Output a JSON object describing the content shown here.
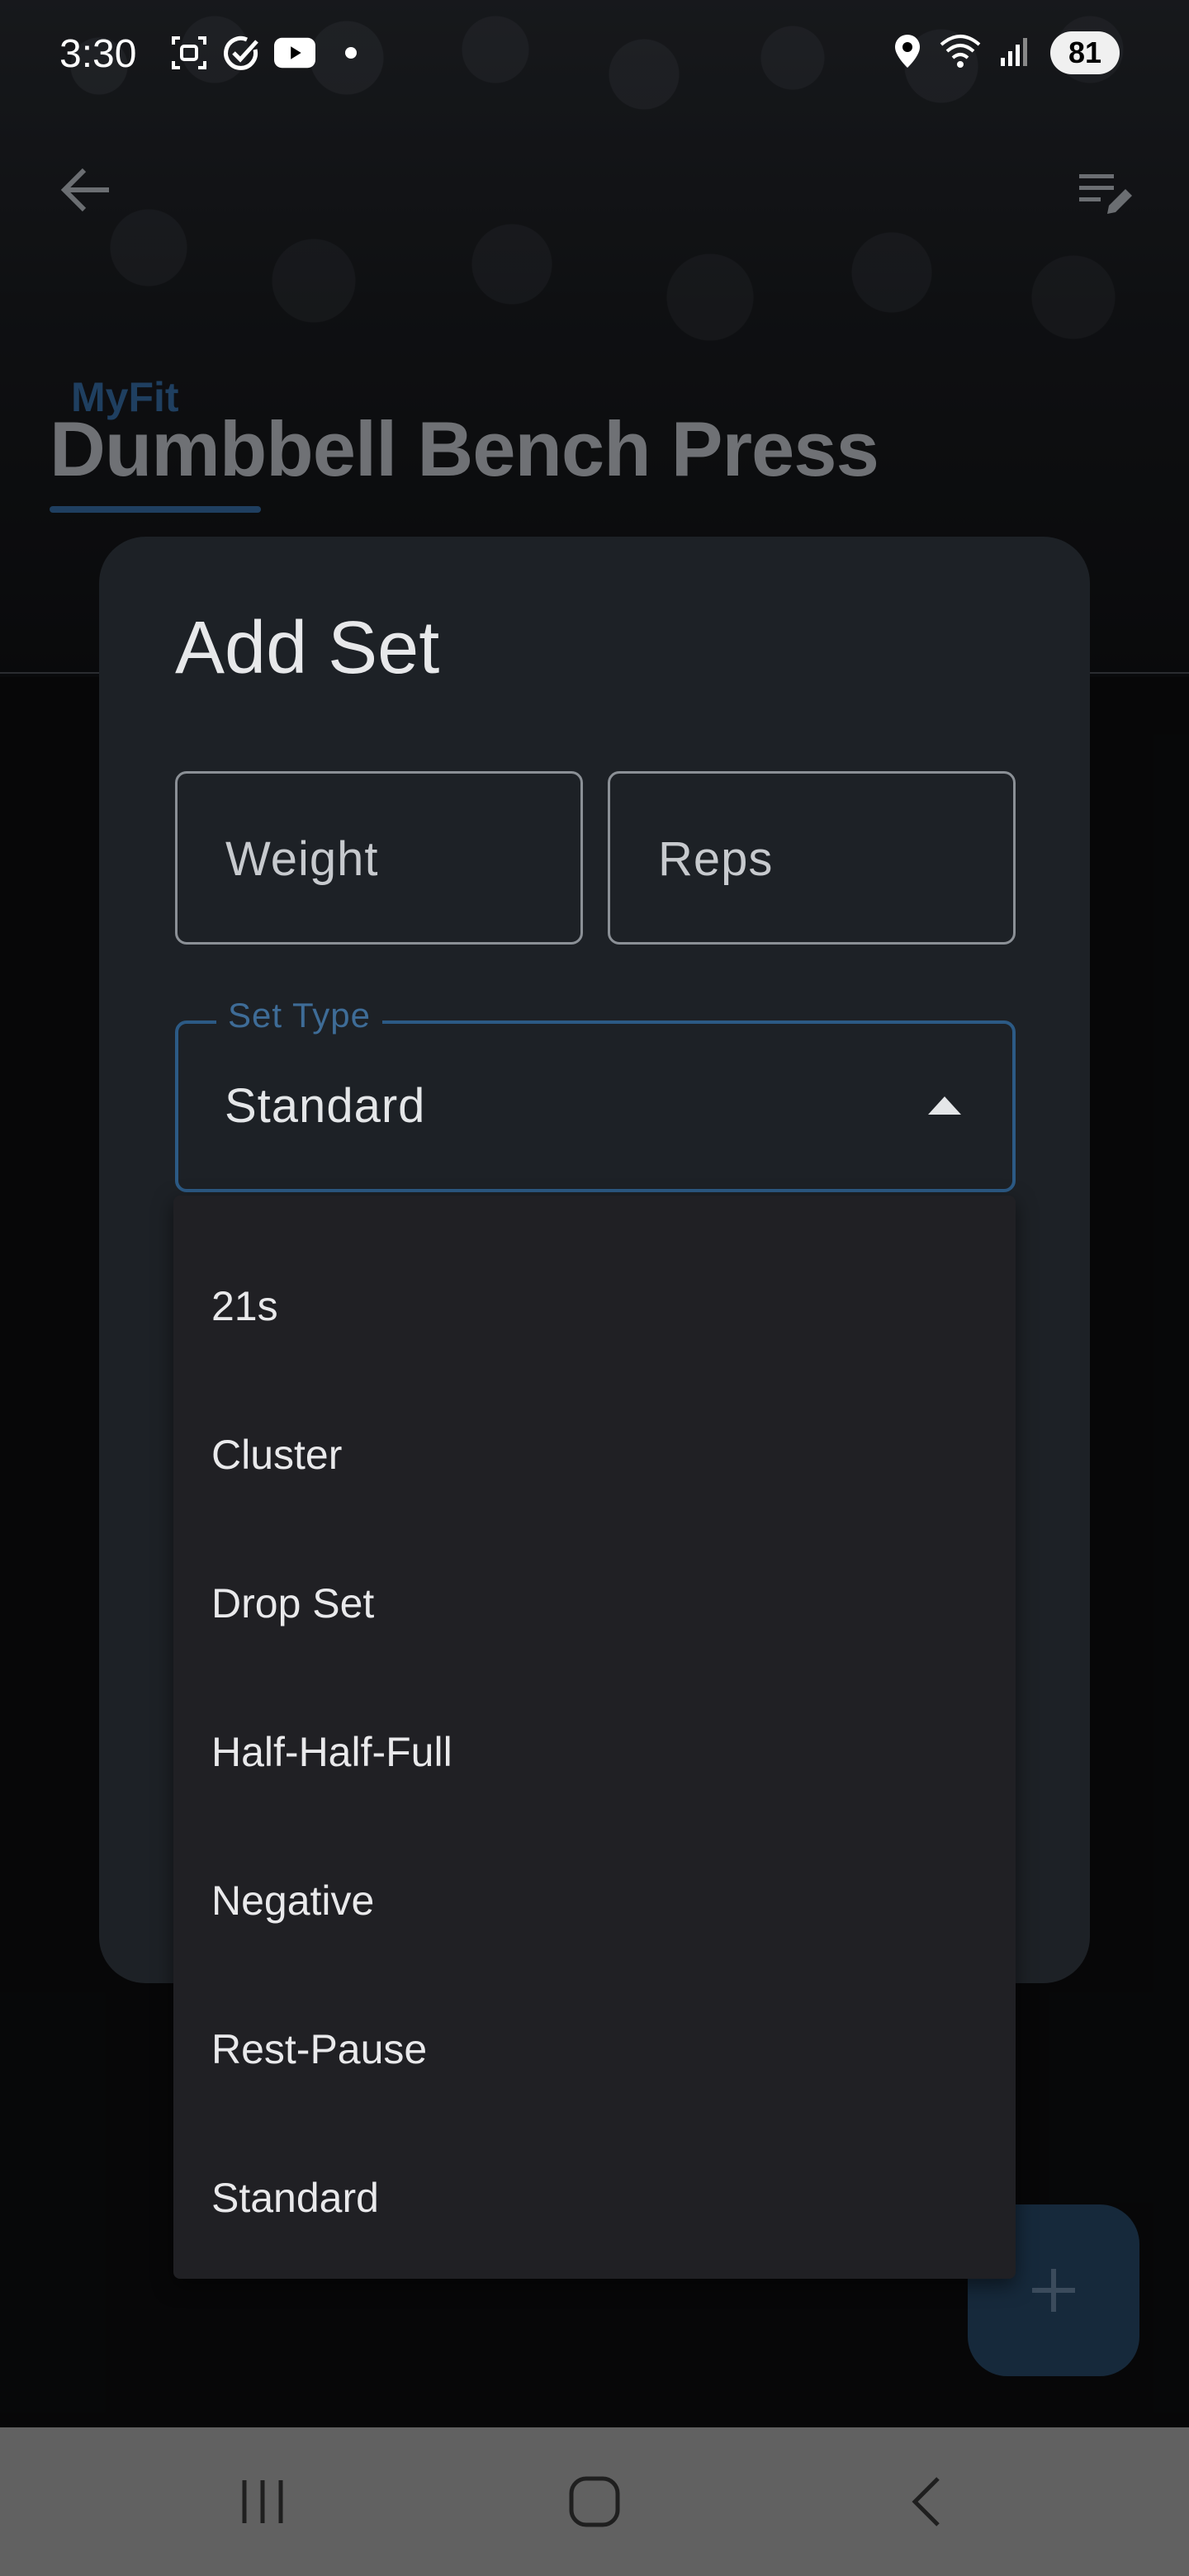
{
  "status_bar": {
    "time": "3:30",
    "battery": "81",
    "icons": [
      "screenshot-icon",
      "check-circle-icon",
      "youtube-icon",
      "dot-icon",
      "location-icon",
      "wifi-icon",
      "signal-icon"
    ]
  },
  "app_bar": {
    "back_icon": "arrow-left-icon",
    "edit_icon": "edit-list-icon"
  },
  "header": {
    "brand": "MyFit",
    "exercise_title": "Dumbbell Bench Press"
  },
  "dialog": {
    "title": "Add Set",
    "weight_placeholder": "Weight",
    "reps_placeholder": "Reps",
    "set_type_label": "Set Type",
    "set_type_value": "Standard"
  },
  "set_type_options": [
    {
      "label": "21s"
    },
    {
      "label": "Cluster"
    },
    {
      "label": "Drop Set"
    },
    {
      "label": "Half-Half-Full"
    },
    {
      "label": "Negative"
    },
    {
      "label": "Rest-Pause"
    },
    {
      "label": "Standard"
    }
  ],
  "fab": {
    "icon": "plus-icon"
  },
  "nav_bar": {
    "icons": [
      "recents-icon",
      "home-icon",
      "back-icon"
    ]
  },
  "colors": {
    "accent": "#2c5a85",
    "dialog_bg": "#1d2126",
    "menu_bg": "#202024",
    "nav_bar": "#616161"
  }
}
